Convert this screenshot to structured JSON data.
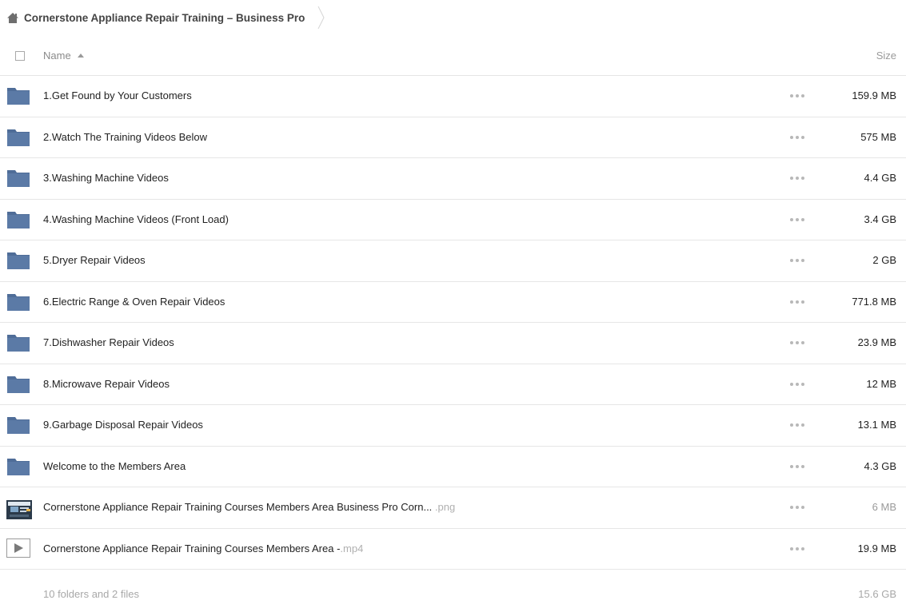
{
  "breadcrumb": {
    "icon": "home-icon",
    "label": "Cornerstone Appliance Repair Training – Business Pro"
  },
  "table": {
    "name_header": "Name",
    "size_header": "Size",
    "sort": "ascending"
  },
  "colors": {
    "folder": "#5b7aa6",
    "folder_tab": "#4f6d98"
  },
  "rows": [
    {
      "type": "folder",
      "icon": "folder-icon",
      "name": "1.Get Found by Your Customers",
      "ext": "",
      "size": "159.9 MB"
    },
    {
      "type": "folder",
      "icon": "folder-icon",
      "name": "2.Watch The Training Videos Below",
      "ext": "",
      "size": "575 MB"
    },
    {
      "type": "folder",
      "icon": "folder-icon",
      "name": "3.Washing Machine Videos",
      "ext": "",
      "size": "4.4 GB"
    },
    {
      "type": "folder",
      "icon": "folder-icon",
      "name": "4.Washing Machine Videos (Front Load)",
      "ext": "",
      "size": "3.4 GB"
    },
    {
      "type": "folder",
      "icon": "folder-icon",
      "name": "5.Dryer Repair Videos",
      "ext": "",
      "size": "2 GB"
    },
    {
      "type": "folder",
      "icon": "folder-icon",
      "name": "6.Electric Range & Oven Repair Videos",
      "ext": "",
      "size": "771.8 MB"
    },
    {
      "type": "folder",
      "icon": "folder-icon",
      "name": "7.Dishwasher Repair Videos",
      "ext": "",
      "size": "23.9 MB"
    },
    {
      "type": "folder",
      "icon": "folder-icon",
      "name": "8.Microwave Repair Videos",
      "ext": "",
      "size": "12 MB"
    },
    {
      "type": "folder",
      "icon": "folder-icon",
      "name": "9.Garbage Disposal Repair Videos",
      "ext": "",
      "size": "13.1 MB"
    },
    {
      "type": "folder",
      "icon": "folder-icon",
      "name": "Welcome to the Members Area",
      "ext": "",
      "size": "4.3 GB"
    },
    {
      "type": "image",
      "icon": "image-thumbnail-icon",
      "name": "Cornerstone Appliance Repair Training Courses Members Area Business Pro Corn...",
      "ext": " .png",
      "size": "6 MB"
    },
    {
      "type": "video",
      "icon": "video-play-icon",
      "name": "Cornerstone Appliance Repair Training Courses Members Area -",
      "ext": ".mp4",
      "size": "19.9 MB"
    }
  ],
  "footer": {
    "summary": "10 folders and 2 files",
    "total": "15.6 GB"
  }
}
